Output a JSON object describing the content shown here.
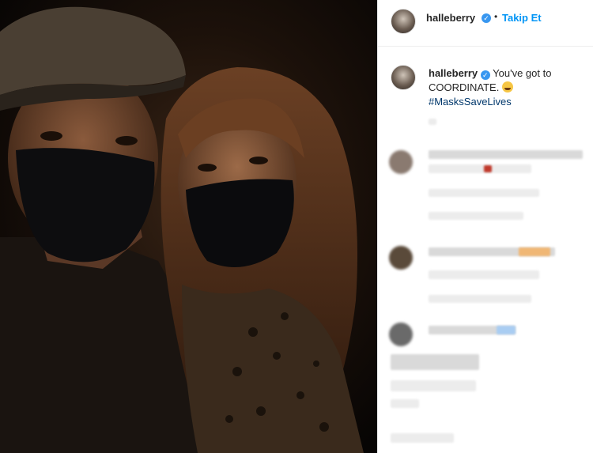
{
  "post": {
    "author": "halleberry",
    "follow_label": "Takip Et",
    "separator": "•",
    "verified_icon": "verified-badge-icon"
  },
  "caption": {
    "author": "halleberry",
    "text": "You've got to COORDINATE.",
    "emoji": "grinning-squinting-face-emoji",
    "hashtag": "#MasksSaveLives"
  },
  "colors": {
    "accent": "#0095f6",
    "verified": "#3897f0",
    "text": "#262626",
    "hashtag": "#00376b"
  }
}
